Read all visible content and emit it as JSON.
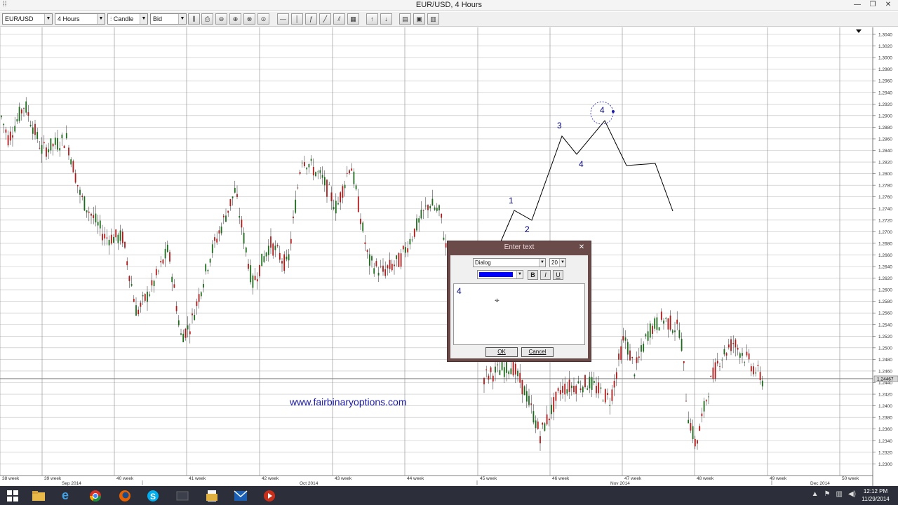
{
  "window": {
    "title": "EUR/USD, 4 Hours"
  },
  "toolbar": {
    "symbol": "EUR/USD",
    "timeframe": "4 Hours",
    "chart_type": "Candle",
    "price_type": "Bid"
  },
  "chart": {
    "price_labels": [
      "1.3040",
      "1.3020",
      "1.3000",
      "1.2980",
      "1.2960",
      "1.2940",
      "1.2920",
      "1.2900",
      "1.2880",
      "1.2860",
      "1.2840",
      "1.2820",
      "1.2800",
      "1.2780",
      "1.2760",
      "1.2740",
      "1.2720",
      "1.2700",
      "1.2680",
      "1.2660",
      "1.2640",
      "1.2620",
      "1.2600",
      "1.2580",
      "1.2560",
      "1.2540",
      "1.2520",
      "1.2500",
      "1.2480",
      "1.2460",
      "1.2440",
      "1.2420",
      "1.2400",
      "1.2380",
      "1.2360",
      "1.2340",
      "1.2320",
      "1.2300"
    ],
    "current_price": "1.24467",
    "week_labels": [
      "38 week",
      "39 week",
      "40 week",
      "41 week",
      "42 week",
      "43 week",
      "44 week",
      "45 week",
      "46 week",
      "47 week",
      "48 week",
      "49 week",
      "50 week"
    ],
    "month_labels": [
      "Sep 2014",
      "Oct 2014",
      "Nov 2014",
      "Dec 2014"
    ],
    "wave_labels": [
      "1",
      "2",
      "3",
      "4",
      "4"
    ],
    "watermark": "www.fairbinaryoptions.com",
    "candle_up_color": "#1e6b1e",
    "candle_down_color": "#b01a1a",
    "wave_line_color": "#000000",
    "wave_label_color": "#000080"
  },
  "dialog": {
    "title": "Enter text",
    "font": "Dialog",
    "size": "20",
    "color": "#0000ff",
    "text": "4",
    "bold": "B",
    "italic": "I",
    "underline": "U",
    "ok": "OK",
    "cancel": "Cancel"
  },
  "taskbar": {
    "time": "12:12 PM",
    "date": "11/29/2014"
  }
}
